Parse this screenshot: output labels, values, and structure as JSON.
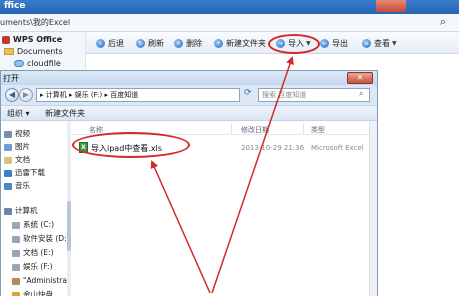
{
  "wps": {
    "title": "ffice",
    "address": "uments\\我的Excel",
    "sidebar": [
      {
        "label": "WPS Office",
        "icon": "wps-logo-icon"
      },
      {
        "label": "Documents",
        "icon": "folder-icon"
      },
      {
        "label": "cloudfile",
        "icon": "cloud-icon"
      }
    ],
    "toolbar": {
      "back": "后退",
      "refresh": "刷新",
      "delete": "删除",
      "new_folder": "新建文件夹",
      "import": "导入",
      "export": "导出",
      "view": "查看"
    }
  },
  "dialog": {
    "title": "打开",
    "close": "✕",
    "path": "▸ 计算机 ▸ 娱乐 (F:) ▸ 百度知道",
    "search_placeholder": "搜索 百度知道",
    "organize": "组织 ▾",
    "new_folder": "新建文件夹",
    "nav": [
      {
        "label": "视频",
        "icon": "video-icon",
        "color": "#7a8fb0"
      },
      {
        "label": "图片",
        "icon": "picture-icon",
        "color": "#6a9fd4"
      },
      {
        "label": "文档",
        "icon": "document-icon",
        "color": "#d9c27a"
      },
      {
        "label": "迅雷下载",
        "icon": "thunder-icon",
        "color": "#3d7fcf"
      },
      {
        "label": "音乐",
        "icon": "music-icon",
        "color": "#4b86c8"
      },
      {
        "label": "计算机",
        "icon": "computer-icon",
        "color": "#6c87a6"
      },
      {
        "label": "系统 (C:)",
        "icon": "drive-icon",
        "color": "#9aa6b4"
      },
      {
        "label": "软件安装 (D:)",
        "icon": "drive-icon",
        "color": "#9aa6b4"
      },
      {
        "label": "文档 (E:)",
        "icon": "drive-icon",
        "color": "#9aa6b4"
      },
      {
        "label": "娱乐 (F:)",
        "icon": "drive-icon",
        "color": "#9aa6b4"
      },
      {
        "label": "\"Administrato",
        "icon": "user-icon",
        "color": "#b48a5a"
      },
      {
        "label": "金山快盘",
        "icon": "cloud-drive-icon",
        "color": "#d9a23a"
      }
    ],
    "columns": {
      "name": "名称",
      "date": "修改日期",
      "type": "类型"
    },
    "file": {
      "name": "导入ipad中查看.xls",
      "date": "2013-10-29 21:36",
      "type": "Microsoft Excel"
    }
  },
  "colors": {
    "annotation": "#d32a2a",
    "accent": "#2663b4"
  }
}
